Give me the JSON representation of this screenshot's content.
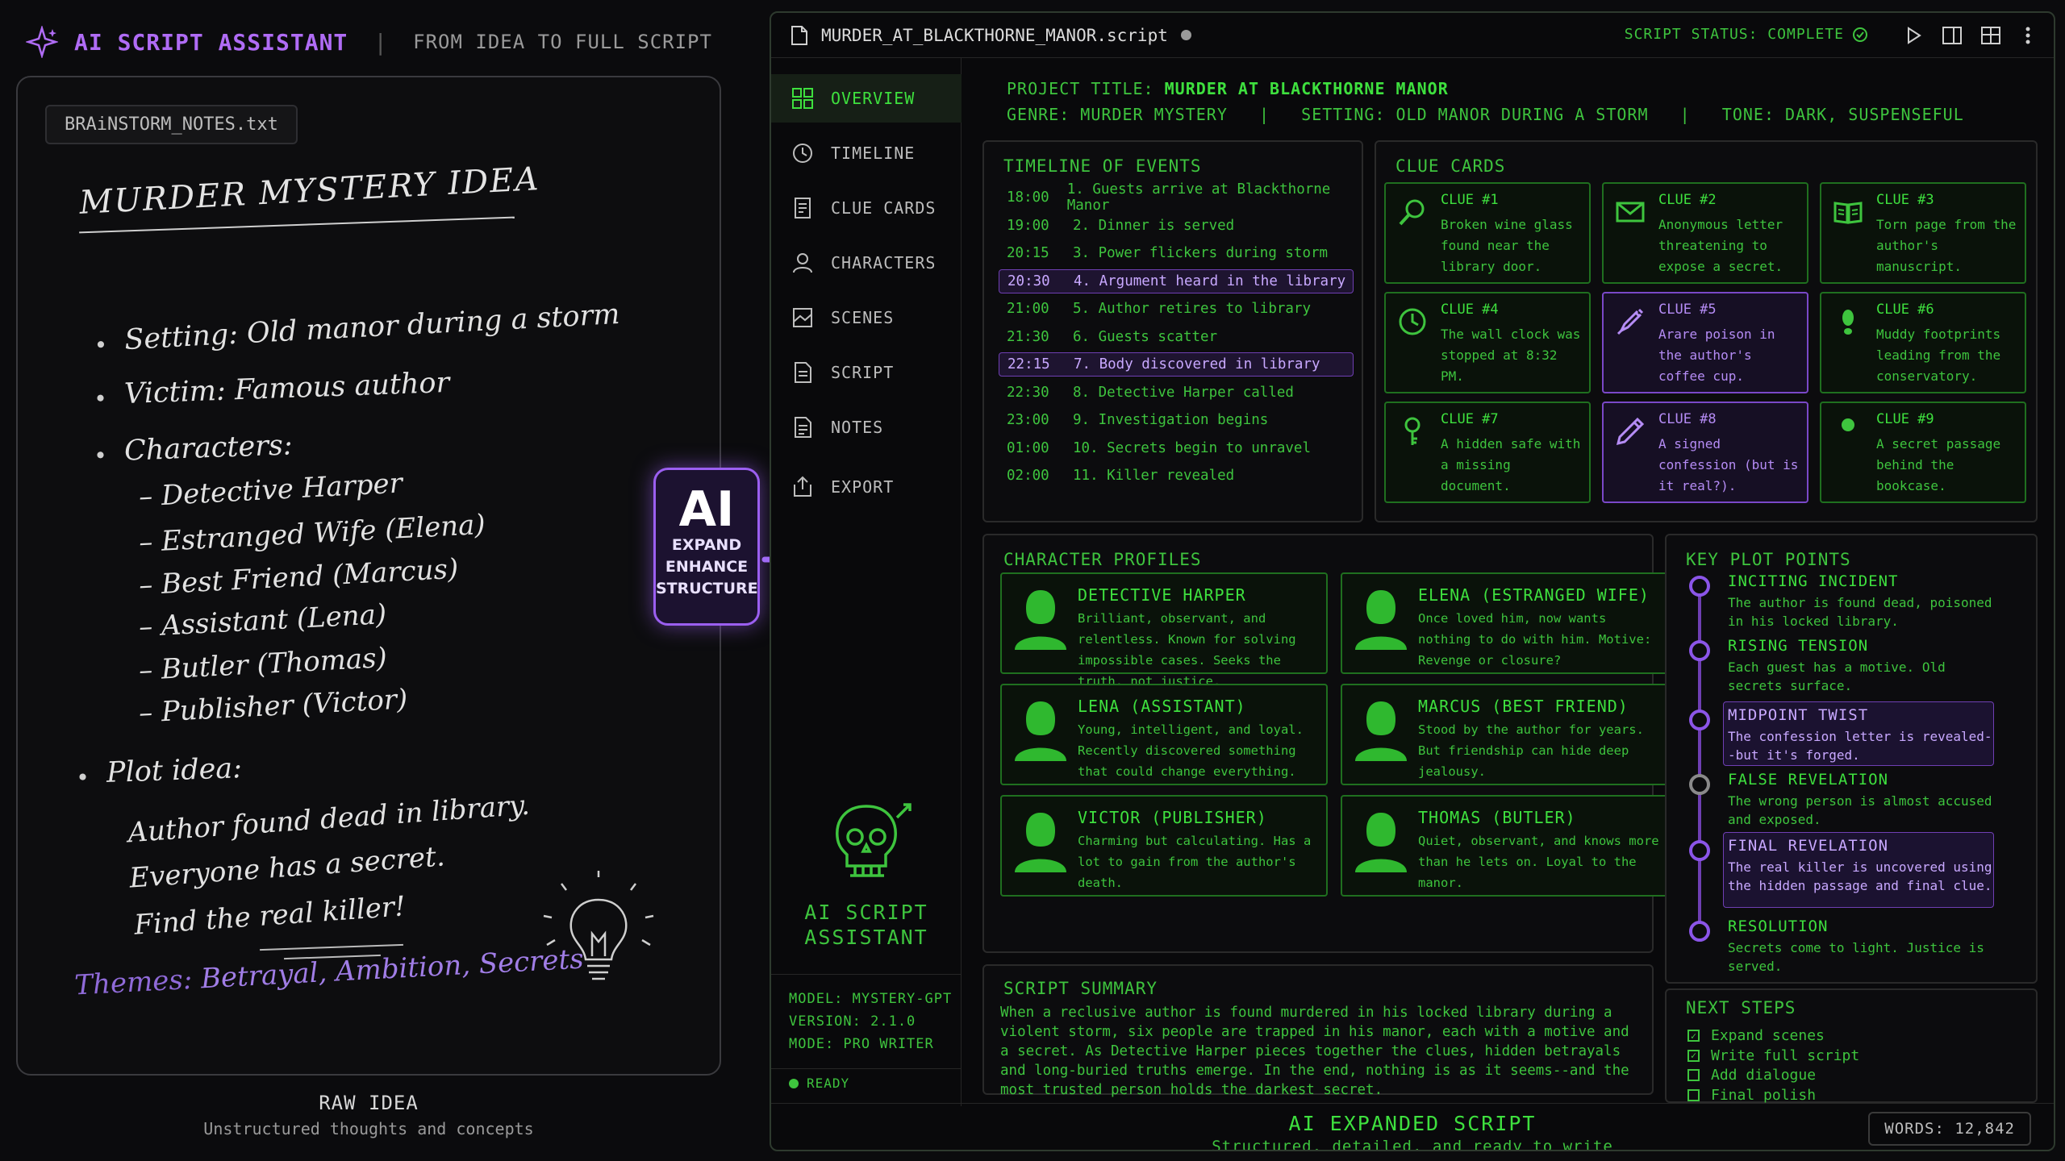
{
  "header": {
    "brand": "AI SCRIPT ASSISTANT",
    "separator": "|",
    "tagline": "FROM IDEA TO FULL SCRIPT"
  },
  "notes": {
    "file_name": "BRAiNSTORM_NOTES.txt",
    "title": "MURDER MYSTERY IDEA",
    "setting": "Setting: Old manor during a storm",
    "victim": "Victim: Famous author",
    "characters_label": "Characters:",
    "characters": [
      "– Detective Harper",
      "– Estranged Wife (Elena)",
      "– Best Friend (Marcus)",
      "– Assistant (Lena)",
      "– Butler (Thomas)",
      "– Publisher (Victor)"
    ],
    "plot_label": "Plot idea:",
    "plot_lines": [
      "Author found dead in library.",
      "Everyone has a secret.",
      "Find the real killer!"
    ],
    "themes_label": "Themes:",
    "themes": "Betrayal, Ambition, Secrets"
  },
  "raw": {
    "label": "RAW IDEA",
    "sub": "Unstructured thoughts and concepts"
  },
  "ai_box": {
    "big": "AI",
    "lines": [
      "EXPAND",
      "ENHANCE",
      "STRUCTURE"
    ]
  },
  "titlebar": {
    "file": "MURDER_AT_BLACKTHORNE_MANOR.script",
    "status": "SCRIPT STATUS: COMPLETE"
  },
  "nav": [
    {
      "label": "OVERVIEW",
      "icon": "overview-icon",
      "active": true
    },
    {
      "label": "TIMELINE",
      "icon": "timeline-icon"
    },
    {
      "label": "CLUE CARDS",
      "icon": "clue-cards-icon"
    },
    {
      "label": "CHARACTERS",
      "icon": "characters-icon"
    },
    {
      "label": "SCENES",
      "icon": "scenes-icon"
    },
    {
      "label": "SCRIPT",
      "icon": "script-icon"
    },
    {
      "label": "NOTES",
      "icon": "notes-icon"
    },
    {
      "label": "EXPORT",
      "icon": "export-icon"
    }
  ],
  "sidebar": {
    "title_1": "AI SCRIPT",
    "title_2": "ASSISTANT",
    "model": "MODEL: MYSTERY-GPT",
    "version": "VERSION: 2.1.0",
    "mode": "MODE: PRO WRITER",
    "ready": "READY"
  },
  "project": {
    "title_label": "PROJECT TITLE:",
    "title": "MURDER AT BLACKTHORNE MANOR",
    "meta": "GENRE: MURDER MYSTERY   |   SETTING: OLD MANOR DURING A STORM   |   TONE: DARK, SUSPENSEFUL"
  },
  "timeline": {
    "heading": "TIMELINE OF EVENTS",
    "events": [
      {
        "time": "18:00",
        "text": "1. Guests arrive at Blackthorne Manor"
      },
      {
        "time": "19:00",
        "text": "2. Dinner is served"
      },
      {
        "time": "20:15",
        "text": "3. Power flickers during storm"
      },
      {
        "time": "20:30",
        "text": "4. Argument heard in the library",
        "hl": true
      },
      {
        "time": "21:00",
        "text": "5. Author retires to library"
      },
      {
        "time": "21:30",
        "text": "6. Guests scatter"
      },
      {
        "time": "22:15",
        "text": "7. Body discovered in library",
        "hl": true
      },
      {
        "time": "22:30",
        "text": "8. Detective Harper called"
      },
      {
        "time": "23:00",
        "text": "9. Investigation begins"
      },
      {
        "time": "01:00",
        "text": "10. Secrets begin to unravel"
      },
      {
        "time": "02:00",
        "text": "11. Killer revealed"
      }
    ]
  },
  "clues": {
    "heading": "CLUE CARDS",
    "cards": [
      {
        "title": "CLUE #1",
        "text": "Broken wine glass found near the library door.",
        "icon": "magnifier-icon"
      },
      {
        "title": "CLUE #2",
        "text": "Anonymous letter threatening to expose a secret.",
        "icon": "envelope-icon"
      },
      {
        "title": "CLUE #3",
        "text": "Torn page from the author's manuscript.",
        "icon": "book-icon"
      },
      {
        "title": "CLUE #4",
        "text": "The wall clock was stopped at 8:32 PM.",
        "icon": "clock-icon"
      },
      {
        "title": "CLUE #5",
        "text": "Arare poison in the author's coffee cup.",
        "icon": "syringe-icon",
        "purple": true
      },
      {
        "title": "CLUE #6",
        "text": "Muddy footprints leading from the conservatory.",
        "icon": "footprint-icon"
      },
      {
        "title": "CLUE #7",
        "text": "A hidden safe with a missing document.",
        "icon": "key-icon"
      },
      {
        "title": "CLUE #8",
        "text": "A signed confession (but is it real?).",
        "icon": "pen-icon",
        "purple": true
      },
      {
        "title": "CLUE #9",
        "text": "A secret passage behind the bookcase.",
        "icon": "person-icon"
      }
    ]
  },
  "characters": {
    "heading": "CHARACTER PROFILES",
    "list": [
      {
        "name": "DETECTIVE HARPER",
        "desc": "Brilliant, observant, and relentless. Known for solving impossible cases. Seeks the truth, not justice."
      },
      {
        "name": "ELENA (ESTRANGED WIFE)",
        "desc": "Once loved him, now wants nothing to do with him. Motive: Revenge or closure?"
      },
      {
        "name": "LENA (ASSISTANT)",
        "desc": "Young, intelligent, and loyal. Recently discovered something that could change everything."
      },
      {
        "name": "MARCUS (BEST FRIEND)",
        "desc": "Stood by the author for years. But friendship can hide deep jealousy."
      },
      {
        "name": "VICTOR (PUBLISHER)",
        "desc": "Charming but calculating. Has a lot to gain from the author's death."
      },
      {
        "name": "THOMAS (BUTLER)",
        "desc": "Quiet, observant, and knows more than he lets on. Loyal to the manor."
      }
    ]
  },
  "plot": {
    "heading": "KEY PLOT POINTS",
    "points": [
      {
        "title": "INCITING INCIDENT",
        "desc": "The author is found dead, poisoned in his locked library."
      },
      {
        "title": "RISING TENSION",
        "desc": "Each guest has a motive. Old secrets surface."
      },
      {
        "title": "MIDPOINT TWIST",
        "desc": "The confession letter is revealed--but it's forged.",
        "hl": true
      },
      {
        "title": "FALSE REVELATION",
        "desc": "The wrong person is almost accused and exposed.",
        "grey": true
      },
      {
        "title": "FINAL REVELATION",
        "desc": "The real killer is uncovered using the hidden passage and final clue.",
        "hl": true
      },
      {
        "title": "RESOLUTION",
        "desc": "Secrets come to light. Justice is served."
      }
    ]
  },
  "summary": {
    "heading": "SCRIPT SUMMARY",
    "text": "When a reclusive author is found murdered in his locked library during a violent storm, six people are trapped in his manor, each with a motive and a secret. As Detective Harper pieces together the clues, hidden betrayals and long-buried truths emerge. In the end, nothing is as it seems--and the most trusted person holds the darkest secret."
  },
  "next_steps": {
    "heading": "NEXT STEPS",
    "items": [
      {
        "label": "Expand scenes",
        "checked": true
      },
      {
        "label": "Write full script",
        "checked": true
      },
      {
        "label": "Add dialogue",
        "checked": false
      },
      {
        "label": "Final polish",
        "checked": false
      }
    ]
  },
  "footer": {
    "title": "AI EXPANDED SCRIPT",
    "sub": "Structured, detailed, and ready to write",
    "words": "WORDS: 12,842"
  },
  "colors": {
    "green": "#3ec43e",
    "purple": "#9b5ff0",
    "bg": "#0b0b0d"
  }
}
